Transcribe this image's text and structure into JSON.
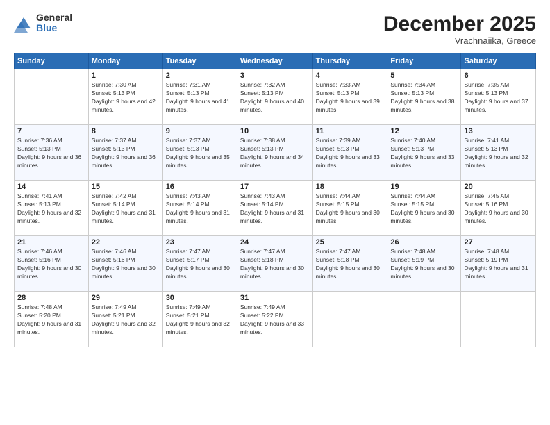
{
  "header": {
    "logo_general": "General",
    "logo_blue": "Blue",
    "month": "December 2025",
    "location": "Vrachnaiika, Greece"
  },
  "days_of_week": [
    "Sunday",
    "Monday",
    "Tuesday",
    "Wednesday",
    "Thursday",
    "Friday",
    "Saturday"
  ],
  "weeks": [
    [
      {
        "day": "",
        "sunrise": "",
        "sunset": "",
        "daylight": ""
      },
      {
        "day": "1",
        "sunrise": "Sunrise: 7:30 AM",
        "sunset": "Sunset: 5:13 PM",
        "daylight": "Daylight: 9 hours and 42 minutes."
      },
      {
        "day": "2",
        "sunrise": "Sunrise: 7:31 AM",
        "sunset": "Sunset: 5:13 PM",
        "daylight": "Daylight: 9 hours and 41 minutes."
      },
      {
        "day": "3",
        "sunrise": "Sunrise: 7:32 AM",
        "sunset": "Sunset: 5:13 PM",
        "daylight": "Daylight: 9 hours and 40 minutes."
      },
      {
        "day": "4",
        "sunrise": "Sunrise: 7:33 AM",
        "sunset": "Sunset: 5:13 PM",
        "daylight": "Daylight: 9 hours and 39 minutes."
      },
      {
        "day": "5",
        "sunrise": "Sunrise: 7:34 AM",
        "sunset": "Sunset: 5:13 PM",
        "daylight": "Daylight: 9 hours and 38 minutes."
      },
      {
        "day": "6",
        "sunrise": "Sunrise: 7:35 AM",
        "sunset": "Sunset: 5:13 PM",
        "daylight": "Daylight: 9 hours and 37 minutes."
      }
    ],
    [
      {
        "day": "7",
        "sunrise": "Sunrise: 7:36 AM",
        "sunset": "Sunset: 5:13 PM",
        "daylight": "Daylight: 9 hours and 36 minutes."
      },
      {
        "day": "8",
        "sunrise": "Sunrise: 7:37 AM",
        "sunset": "Sunset: 5:13 PM",
        "daylight": "Daylight: 9 hours and 36 minutes."
      },
      {
        "day": "9",
        "sunrise": "Sunrise: 7:37 AM",
        "sunset": "Sunset: 5:13 PM",
        "daylight": "Daylight: 9 hours and 35 minutes."
      },
      {
        "day": "10",
        "sunrise": "Sunrise: 7:38 AM",
        "sunset": "Sunset: 5:13 PM",
        "daylight": "Daylight: 9 hours and 34 minutes."
      },
      {
        "day": "11",
        "sunrise": "Sunrise: 7:39 AM",
        "sunset": "Sunset: 5:13 PM",
        "daylight": "Daylight: 9 hours and 33 minutes."
      },
      {
        "day": "12",
        "sunrise": "Sunrise: 7:40 AM",
        "sunset": "Sunset: 5:13 PM",
        "daylight": "Daylight: 9 hours and 33 minutes."
      },
      {
        "day": "13",
        "sunrise": "Sunrise: 7:41 AM",
        "sunset": "Sunset: 5:13 PM",
        "daylight": "Daylight: 9 hours and 32 minutes."
      }
    ],
    [
      {
        "day": "14",
        "sunrise": "Sunrise: 7:41 AM",
        "sunset": "Sunset: 5:13 PM",
        "daylight": "Daylight: 9 hours and 32 minutes."
      },
      {
        "day": "15",
        "sunrise": "Sunrise: 7:42 AM",
        "sunset": "Sunset: 5:14 PM",
        "daylight": "Daylight: 9 hours and 31 minutes."
      },
      {
        "day": "16",
        "sunrise": "Sunrise: 7:43 AM",
        "sunset": "Sunset: 5:14 PM",
        "daylight": "Daylight: 9 hours and 31 minutes."
      },
      {
        "day": "17",
        "sunrise": "Sunrise: 7:43 AM",
        "sunset": "Sunset: 5:14 PM",
        "daylight": "Daylight: 9 hours and 31 minutes."
      },
      {
        "day": "18",
        "sunrise": "Sunrise: 7:44 AM",
        "sunset": "Sunset: 5:15 PM",
        "daylight": "Daylight: 9 hours and 30 minutes."
      },
      {
        "day": "19",
        "sunrise": "Sunrise: 7:44 AM",
        "sunset": "Sunset: 5:15 PM",
        "daylight": "Daylight: 9 hours and 30 minutes."
      },
      {
        "day": "20",
        "sunrise": "Sunrise: 7:45 AM",
        "sunset": "Sunset: 5:16 PM",
        "daylight": "Daylight: 9 hours and 30 minutes."
      }
    ],
    [
      {
        "day": "21",
        "sunrise": "Sunrise: 7:46 AM",
        "sunset": "Sunset: 5:16 PM",
        "daylight": "Daylight: 9 hours and 30 minutes."
      },
      {
        "day": "22",
        "sunrise": "Sunrise: 7:46 AM",
        "sunset": "Sunset: 5:16 PM",
        "daylight": "Daylight: 9 hours and 30 minutes."
      },
      {
        "day": "23",
        "sunrise": "Sunrise: 7:47 AM",
        "sunset": "Sunset: 5:17 PM",
        "daylight": "Daylight: 9 hours and 30 minutes."
      },
      {
        "day": "24",
        "sunrise": "Sunrise: 7:47 AM",
        "sunset": "Sunset: 5:18 PM",
        "daylight": "Daylight: 9 hours and 30 minutes."
      },
      {
        "day": "25",
        "sunrise": "Sunrise: 7:47 AM",
        "sunset": "Sunset: 5:18 PM",
        "daylight": "Daylight: 9 hours and 30 minutes."
      },
      {
        "day": "26",
        "sunrise": "Sunrise: 7:48 AM",
        "sunset": "Sunset: 5:19 PM",
        "daylight": "Daylight: 9 hours and 30 minutes."
      },
      {
        "day": "27",
        "sunrise": "Sunrise: 7:48 AM",
        "sunset": "Sunset: 5:19 PM",
        "daylight": "Daylight: 9 hours and 31 minutes."
      }
    ],
    [
      {
        "day": "28",
        "sunrise": "Sunrise: 7:48 AM",
        "sunset": "Sunset: 5:20 PM",
        "daylight": "Daylight: 9 hours and 31 minutes."
      },
      {
        "day": "29",
        "sunrise": "Sunrise: 7:49 AM",
        "sunset": "Sunset: 5:21 PM",
        "daylight": "Daylight: 9 hours and 32 minutes."
      },
      {
        "day": "30",
        "sunrise": "Sunrise: 7:49 AM",
        "sunset": "Sunset: 5:21 PM",
        "daylight": "Daylight: 9 hours and 32 minutes."
      },
      {
        "day": "31",
        "sunrise": "Sunrise: 7:49 AM",
        "sunset": "Sunset: 5:22 PM",
        "daylight": "Daylight: 9 hours and 33 minutes."
      },
      {
        "day": "",
        "sunrise": "",
        "sunset": "",
        "daylight": ""
      },
      {
        "day": "",
        "sunrise": "",
        "sunset": "",
        "daylight": ""
      },
      {
        "day": "",
        "sunrise": "",
        "sunset": "",
        "daylight": ""
      }
    ]
  ]
}
